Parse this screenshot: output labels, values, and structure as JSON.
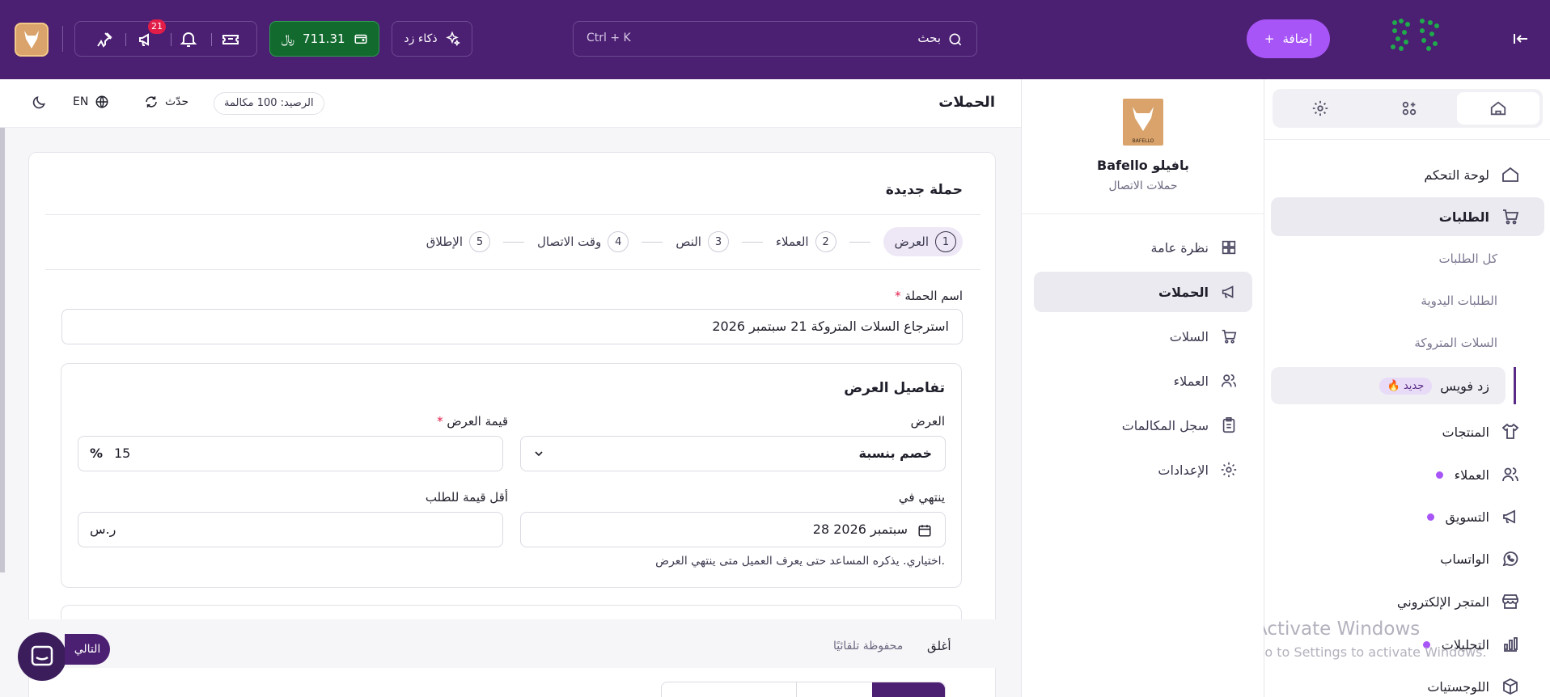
{
  "topbar": {
    "add_label": "إضافة",
    "search_placeholder": "بحث",
    "search_shortcut": "Ctrl + K",
    "ai_label": "ذكاء زد",
    "wallet_amount": "711.31",
    "notification_count": "21",
    "accent_color": "#a855f7",
    "bar_color": "#4b1f72"
  },
  "sidebar": {
    "items": [
      {
        "label": "لوحة التحكم",
        "icon": "home-icon"
      },
      {
        "label": "الطلبات",
        "icon": "cart-icon"
      },
      {
        "label": "المنتجات",
        "icon": "shirt-icon"
      },
      {
        "label": "العملاء",
        "icon": "users-icon"
      },
      {
        "label": "التسويق",
        "icon": "megaphone-icon"
      },
      {
        "label": "الواتساب",
        "icon": "whatsapp-icon"
      },
      {
        "label": "المتجر الإلكتروني",
        "icon": "store-icon"
      },
      {
        "label": "التحليلات",
        "icon": "chart-icon"
      },
      {
        "label": "اللوجستيات",
        "icon": "box-icon"
      }
    ],
    "sub_items": [
      "كل الطلبات",
      "الطلبات اليدوية",
      "السلات المتروكة"
    ],
    "zid_voice": {
      "label": "زد فويس",
      "badge": "جديد"
    }
  },
  "app": {
    "name": "Bafello بافيلو",
    "subtitle": "حملات الاتصال",
    "logo_text": "BAFELLO",
    "menu": [
      {
        "label": "نظرة عامة",
        "icon": "grid-icon"
      },
      {
        "label": "الحملات",
        "icon": "megaphone-icon"
      },
      {
        "label": "السلات",
        "icon": "cart-icon"
      },
      {
        "label": "العملاء",
        "icon": "users-icon"
      },
      {
        "label": "سجل المكالمات",
        "icon": "clipboard-icon"
      },
      {
        "label": "الإعدادات",
        "icon": "gear-icon"
      }
    ]
  },
  "header": {
    "title": "الحملات",
    "balance": "الرصيد: 100 مكالمة",
    "refresh": "حدّث",
    "lang": "EN"
  },
  "form": {
    "title": "حملة جديدة",
    "steps": [
      {
        "num": "1",
        "label": "العرض"
      },
      {
        "num": "2",
        "label": "العملاء"
      },
      {
        "num": "3",
        "label": "النص"
      },
      {
        "num": "4",
        "label": "وقت الاتصال"
      },
      {
        "num": "5",
        "label": "الإطلاق"
      }
    ],
    "campaign_name_label": "اسم الحملة",
    "campaign_name_value": "استرجاع السلات المتروكة 21 سبتمبر 2026",
    "offer_section_title": "تفاصيل العرض",
    "offer_label": "العرض",
    "offer_value": "خصم بنسبة",
    "offer_value_label": "قيمة العرض",
    "offer_value_value": "15",
    "offer_value_unit": "%",
    "ends_label": "ينتهي في",
    "ends_value": "28 سبتمبر 2026",
    "min_order_label": "أقل قيمة للطلب",
    "min_order_unit": "ر.س",
    "hint": "اختياري. يذكره المساعد حتى يعرف العميل متى ينتهي العرض.",
    "close_label": "أغلق",
    "autosaved": "محفوظة تلقائيًا",
    "next_label": "التالي"
  },
  "watermark": {
    "line1": "Activate Windows",
    "line2": "Go to Settings to activate Windows."
  }
}
